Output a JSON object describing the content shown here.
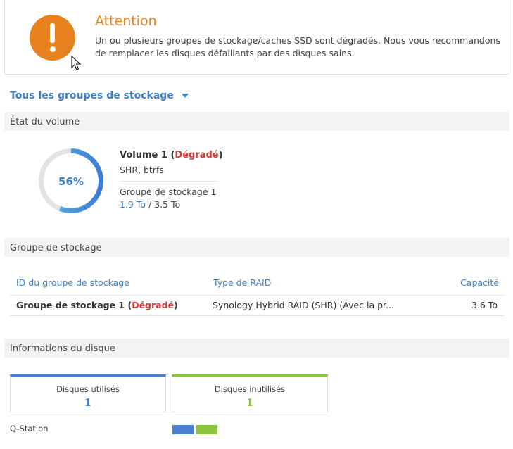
{
  "alert": {
    "title": "Attention",
    "message": "Un ou plusieurs groupes de stockage/caches SSD sont dégradés. Nous vous recommandons de remplacer les disques défaillants par des disques sains."
  },
  "group_selector": {
    "label": "Tous les groupes de stockage"
  },
  "volume_section": {
    "header": "État du volume",
    "usage_percent": 56,
    "usage_label": "56%",
    "name": "Volume 1",
    "status": "Dégradé",
    "fs": "SHR, btrfs",
    "pool": "Groupe de stockage 1",
    "used": "1.9 To",
    "sep": "/",
    "total": "3.5 To"
  },
  "pool_section": {
    "header": "Groupe de stockage",
    "columns": [
      "ID du groupe de stockage",
      "Type de RAID",
      "Capacité"
    ],
    "rows": [
      {
        "id": "Groupe de stockage 1",
        "status": "Dégradé",
        "raid": "Synology Hybrid RAID (SHR) (Avec la pr...",
        "capacity": "3.6 To"
      }
    ]
  },
  "disk_section": {
    "header": "Informations du disque",
    "used_label": "Disques utilisés",
    "used_count": "1",
    "unused_label": "Disques inutilisés",
    "unused_count": "1",
    "device": "Q-Station"
  },
  "colors": {
    "accent": "#3d7fc6",
    "warning": "#e8821f",
    "degraded": "#d0403a",
    "used": "#4a7fcb",
    "unused": "#8cc43f"
  }
}
